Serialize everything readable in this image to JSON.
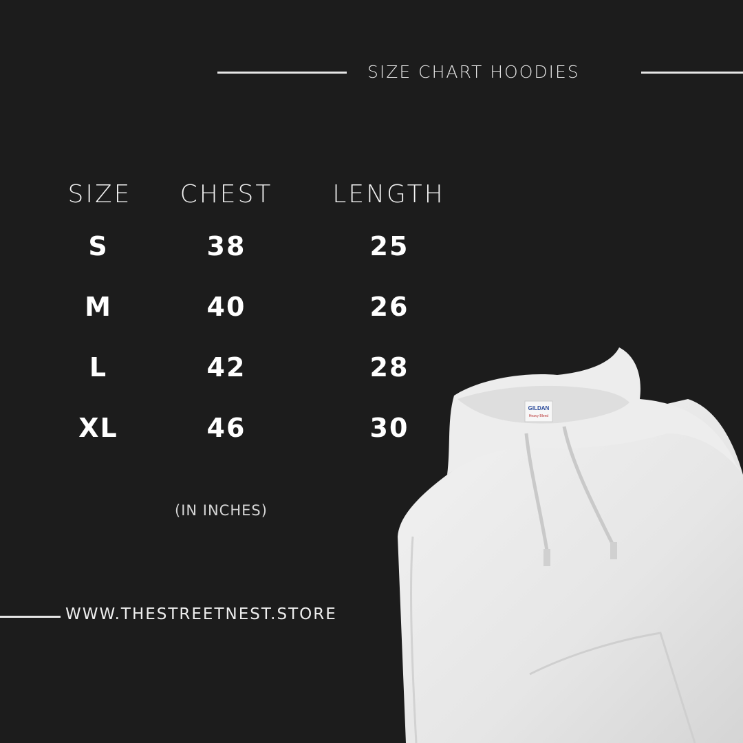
{
  "title": "SIZE CHART HOODIES",
  "table": {
    "headers": [
      "SIZE",
      "CHEST",
      "LENGTH"
    ],
    "rows": [
      {
        "size": "S",
        "chest": "38",
        "length": "25"
      },
      {
        "size": "M",
        "chest": "40",
        "length": "26"
      },
      {
        "size": "L",
        "chest": "42",
        "length": "28"
      },
      {
        "size": "XL",
        "chest": "46",
        "length": "30"
      }
    ]
  },
  "unit_note": "(IN INCHES)",
  "website": "WWW.THESTREETNEST.STORE",
  "hoodie_label": {
    "brand": "GILDAN",
    "sub": "Heavy Blend"
  },
  "colors": {
    "background": "#1c1c1c",
    "text": "#ffffff",
    "hoodie": "#e9e9e9"
  }
}
